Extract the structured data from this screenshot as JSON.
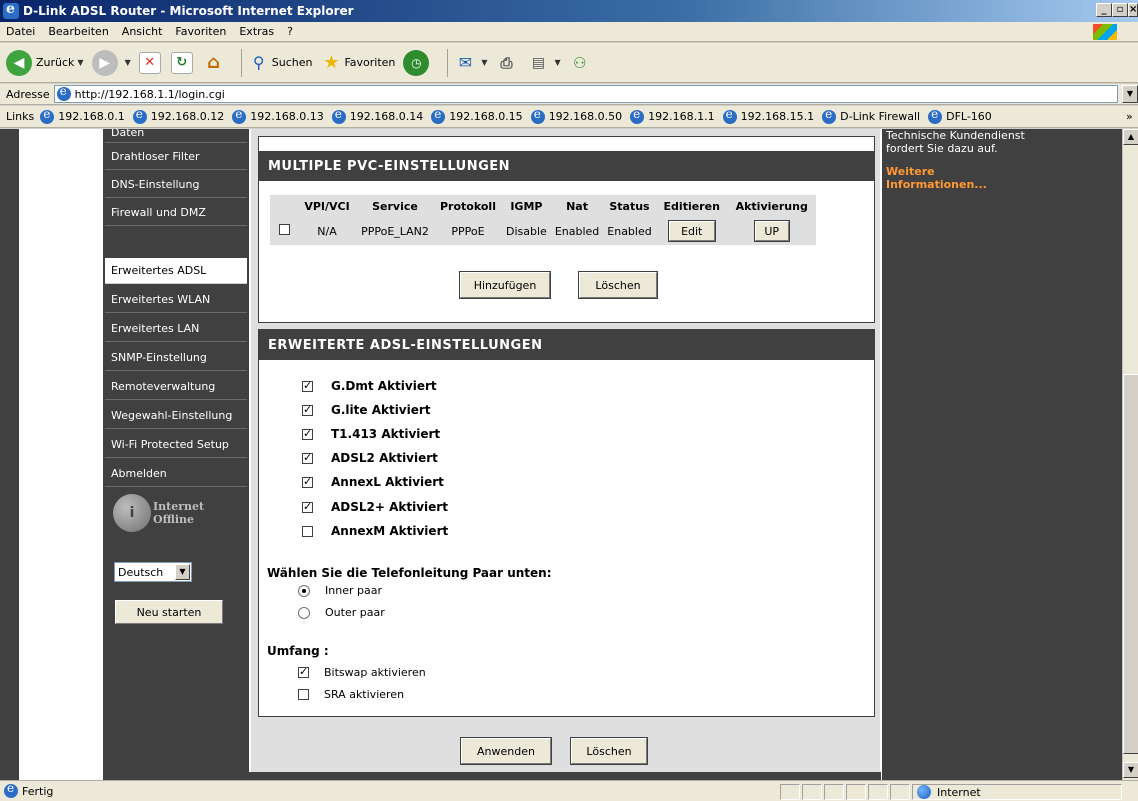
{
  "window": {
    "title": "D-Link ADSL Router - Microsoft Internet Explorer",
    "min_label": "_",
    "max_label": "▫",
    "close_label": "×"
  },
  "menu": [
    "Datei",
    "Bearbeiten",
    "Ansicht",
    "Favoriten",
    "Extras",
    "?"
  ],
  "toolbar": {
    "back_label": "Zurück",
    "search_label": "Suchen",
    "favorites_label": "Favoriten"
  },
  "address": {
    "label": "Adresse",
    "url": "http://192.168.1.1/login.cgi"
  },
  "links": {
    "label": "Links",
    "items": [
      "192.168.0.1",
      "192.168.0.12",
      "192.168.0.13",
      "192.168.0.14",
      "192.168.0.15",
      "192.168.0.50",
      "192.168.1.1",
      "192.168.15.1",
      "D-Link Firewall",
      "DFL-160"
    ],
    "overflow": "»"
  },
  "nav": {
    "items": [
      "Daten",
      "Drahtloser Filter",
      "DNS-Einstellung",
      "Firewall und DMZ",
      "Erweitertes ADSL",
      "Erweitertes WLAN",
      "Erweitertes LAN",
      "SNMP-Einstellung",
      "Remoteverwaltung",
      "Wegewahl-Einstellung",
      "Wi-Fi Protected Setup",
      "Abmelden"
    ],
    "active_index": 4,
    "status_line1": "Internet",
    "status_line2": "Offline",
    "language": "Deutsch",
    "restart_label": "Neu starten"
  },
  "pvc": {
    "title": "MULTIPLE PVC-EINSTELLUNGEN",
    "headers": [
      "VPI/VCI",
      "Service",
      "Protokoll",
      "IGMP",
      "Nat",
      "Status",
      "Editieren",
      "Aktivierung"
    ],
    "row": {
      "vpi_vci": "N/A",
      "service": "PPPoE_LAN2",
      "protocol": "PPPoE",
      "igmp": "Disable",
      "nat": "Enabled",
      "status": "Enabled",
      "edit_label": "Edit",
      "activation_label": "UP",
      "checked": false
    },
    "add_label": "Hinzufügen",
    "delete_label": "Löschen"
  },
  "adsl": {
    "title": "ERWEITERTE ADSL-EINSTELLUNGEN",
    "options": [
      {
        "label": "G.Dmt Aktiviert",
        "checked": true
      },
      {
        "label": "G.lite Aktiviert",
        "checked": true
      },
      {
        "label": "T1.413 Aktiviert",
        "checked": true
      },
      {
        "label": "ADSL2 Aktiviert",
        "checked": true
      },
      {
        "label": "AnnexL Aktiviert",
        "checked": true
      },
      {
        "label": "ADSL2+ Aktiviert",
        "checked": true
      },
      {
        "label": "AnnexM Aktiviert",
        "checked": false
      }
    ],
    "line_pair_title": "Wählen Sie die Telefonleitung Paar unten:",
    "line_pairs": [
      {
        "label": "Inner paar",
        "checked": true
      },
      {
        "label": "Outer paar",
        "checked": false
      }
    ],
    "scope_title": "Umfang :",
    "scope": [
      {
        "label": "Bitswap aktivieren",
        "checked": true
      },
      {
        "label": "SRA aktivieren",
        "checked": false
      }
    ],
    "apply_label": "Anwenden",
    "delete_label": "Löschen"
  },
  "help": {
    "text": "Technische Kundendienst fordert Sie dazu auf.",
    "more_link": "Weitere Informationen..."
  },
  "status": {
    "left": "Fertig",
    "zone": "Internet"
  }
}
